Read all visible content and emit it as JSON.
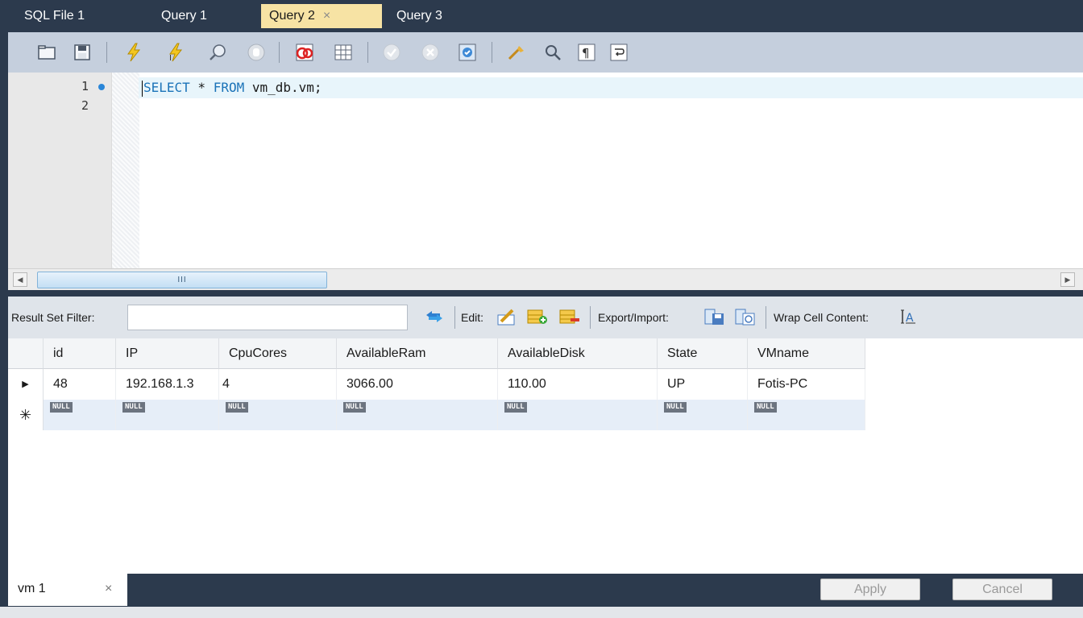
{
  "tabs": [
    {
      "label": "SQL File 1",
      "active": false
    },
    {
      "label": "Query 1",
      "active": false
    },
    {
      "label": "Query 2",
      "active": true,
      "close": "×"
    },
    {
      "label": "Query 3",
      "active": false
    }
  ],
  "toolbar_icons": [
    "open-folder-icon",
    "save-icon",
    "execute-icon",
    "execute-current-icon",
    "explain-icon",
    "stop-icon",
    "toggle-continue-on-error-icon",
    "toggle-results-icon",
    "commit-icon",
    "rollback-icon",
    "autocommit-icon",
    "beautify-icon",
    "find-icon",
    "invisible-chars-icon",
    "word-wrap-icon"
  ],
  "editor": {
    "line_numbers": [
      "1",
      "2"
    ],
    "keyword1": "SELECT",
    "star": " * ",
    "keyword2": "FROM",
    "rest": " vm_db.vm;"
  },
  "scrollbar": {
    "thumb_grip": "III",
    "left_arrow": "◀",
    "right_arrow": "▶"
  },
  "result_toolbar": {
    "filter_label": "Result Set Filter:",
    "filter_value": "",
    "edit_label": "Edit:",
    "export_label": "Export/Import:",
    "wrap_label": "Wrap Cell Content:"
  },
  "grid": {
    "columns": [
      "id",
      "IP",
      "CpuCores",
      "AvailableRam",
      "AvailableDisk",
      "State",
      "VMname"
    ],
    "rows": [
      [
        "48",
        "192.168.1.3",
        "4",
        "3066.00",
        "110.00",
        "UP",
        "Fotis-PC"
      ]
    ],
    "null_label": "NULL",
    "current_row_marker": "▶",
    "new_row_marker": "✳"
  },
  "result_tab": {
    "label": "vm 1",
    "close": "×"
  },
  "buttons": {
    "apply": "Apply",
    "cancel": "Cancel"
  }
}
